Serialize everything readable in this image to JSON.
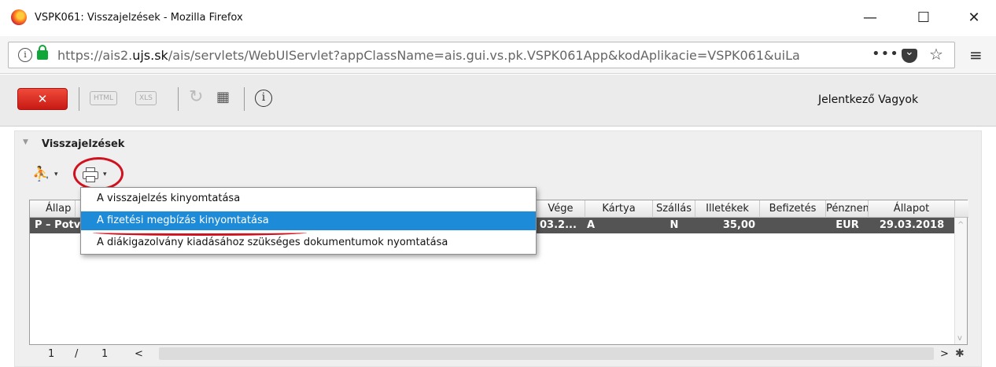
{
  "window": {
    "title": "VSPK061: Visszajelzések - Mozilla Firefox",
    "minimize": "—",
    "maximize": "☐",
    "close": "✕"
  },
  "urlbar": {
    "url_prefix": "https://ais2.",
    "url_domain": "ujs.sk",
    "url_rest": "/ais/servlets/WebUIServlet?appClassName=ais.gui.vs.pk.VSPK061App&kodAplikacie=VSPK061&uiLa",
    "more": "•••",
    "star": "☆",
    "menu": "≡"
  },
  "toolbar": {
    "close_label": "✕",
    "html_label": "HTML",
    "xls_label": "XLS",
    "refresh": "↻",
    "grid": "𝄜",
    "info": "i",
    "user": "Jelentkező Vagyok"
  },
  "panel": {
    "collapse": "▼",
    "title": "Visszajelzések",
    "runner": "🏃",
    "caret": "▾"
  },
  "table": {
    "headers": [
      "Állap",
      "Vége",
      "Kártya",
      "Szállás",
      "Illetékek",
      "Befizetés",
      "Pénznem",
      "Állapot"
    ],
    "row": [
      "P – Potv",
      "03.2...",
      "A",
      "N",
      "35,00",
      "",
      "EUR",
      "29.03.2018"
    ]
  },
  "pager": {
    "page": "1",
    "sep": "/",
    "total": "1",
    "prev": "<",
    "next": ">",
    "gear": "✱"
  },
  "menu": {
    "items": [
      "A visszajelzés kinyomtatása",
      "A fizetési megbízás kinyomtatása",
      "A diákigazolvány kiadásához szükséges dokumentumok nyomtatása"
    ],
    "highlighted_index": 1
  },
  "colors": {
    "highlight": "#1e8bd8",
    "annotation": "#d0121e",
    "close_button": "#e0302a"
  }
}
